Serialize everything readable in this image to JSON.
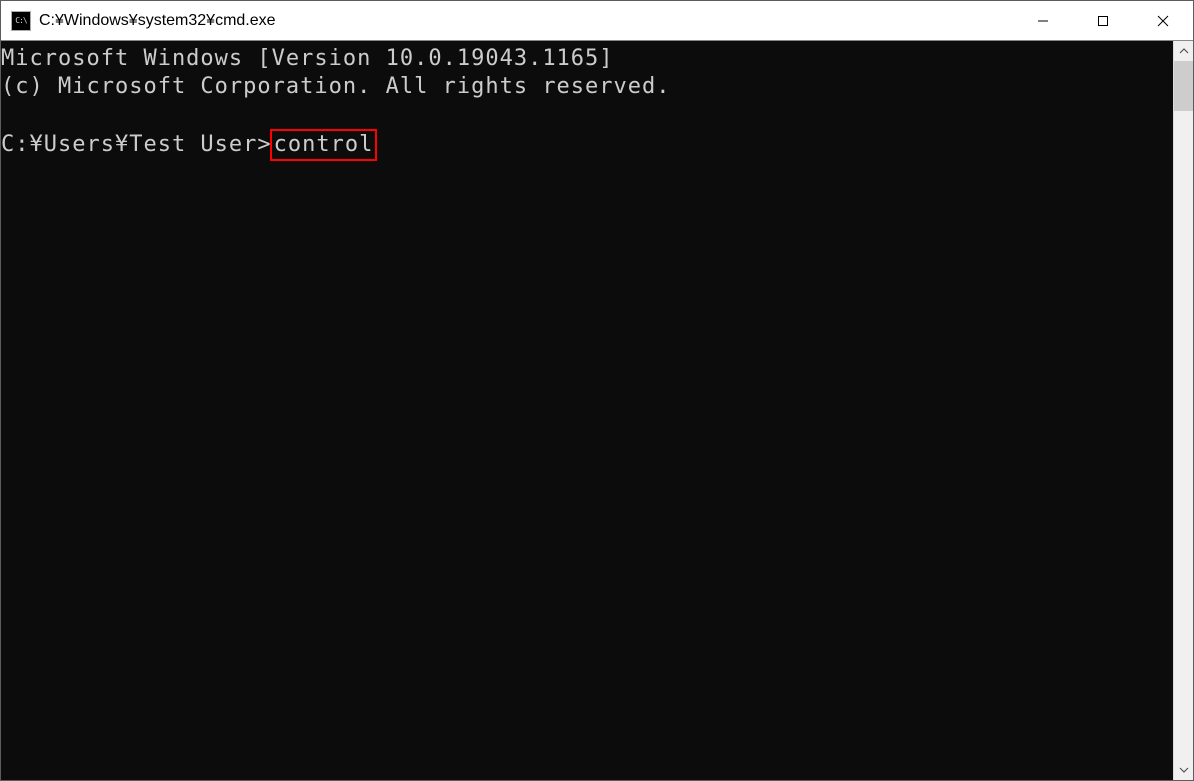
{
  "titlebar": {
    "icon_label": "C:\\",
    "title": "C:¥Windows¥system32¥cmd.exe"
  },
  "terminal": {
    "line1": "Microsoft Windows [Version 10.0.19043.1165]",
    "line2": "(c) Microsoft Corporation. All rights reserved.",
    "blank": "",
    "prompt": "C:¥Users¥Test User>",
    "command": "control"
  }
}
